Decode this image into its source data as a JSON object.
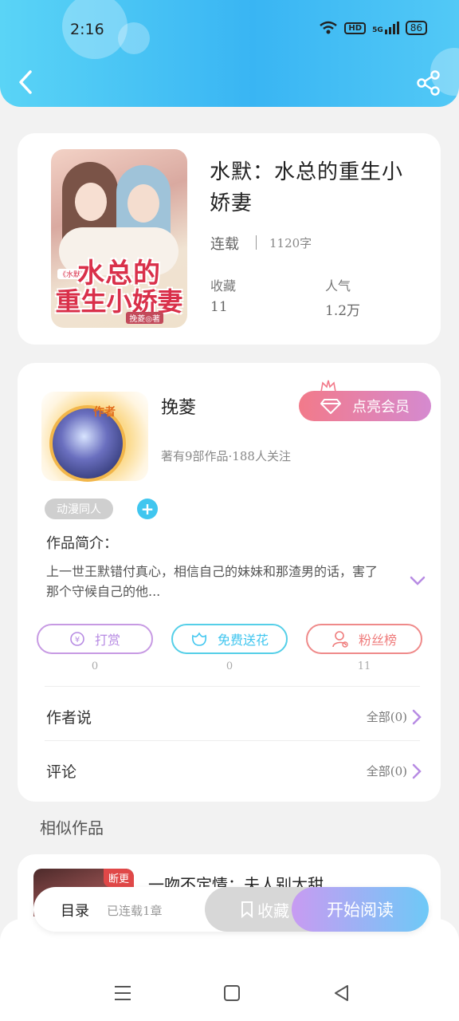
{
  "status_bar": {
    "time": "2:16",
    "network": "5G",
    "hd": "HD",
    "battery": "86"
  },
  "colors": {
    "header_start": "#5ad4f6",
    "header_end": "#39b5f3",
    "accent_pink": "#f27a8a",
    "accent_purple": "#b78be3",
    "accent_cyan": "#40c6ef",
    "accent_coral": "#ef7c7c"
  },
  "header": {
    "back_icon": "chevron-left-icon",
    "share_icon": "share-icon"
  },
  "book": {
    "title": "水默：水总的重生小娇妻",
    "status": "连载",
    "words": "1120字",
    "cover_title_line1": "水总的",
    "cover_title_line2": "重生小娇妻",
    "cover_tag": "《水默》",
    "cover_author": "挽菱◎著",
    "stats": [
      {
        "label": "收藏",
        "value": "11"
      },
      {
        "label": "人气",
        "value": "1.2万"
      }
    ]
  },
  "author": {
    "badge": "作者",
    "name": "挽菱",
    "meta": "著有9部作品·188人关注",
    "vip_button": "点亮会员",
    "tag": "动漫同人",
    "add_tag": "+"
  },
  "intro": {
    "label": "作品简介：",
    "text": "上一世王默错付真心，相信自己的妹妹和那渣男的话，害了那个守候自己的他..."
  },
  "actions": [
    {
      "label": "打赏",
      "icon": "yen-icon",
      "count": "0"
    },
    {
      "label": "免费送花",
      "icon": "flower-icon",
      "count": "0"
    },
    {
      "label": "粉丝榜",
      "icon": "user-rank-icon",
      "count": "11"
    }
  ],
  "rows": [
    {
      "label": "作者说",
      "right": "全部(0)"
    },
    {
      "label": "评论",
      "right": "全部(0)"
    }
  ],
  "similar": {
    "title": "相似作品",
    "items": [
      {
        "badge": "断更",
        "title": "一吻不定情：夫人别太甜"
      }
    ]
  },
  "bottom_bar": {
    "catalog": "目录",
    "chapter": "已连载1章",
    "collect": "收藏",
    "read": "开始阅读"
  }
}
